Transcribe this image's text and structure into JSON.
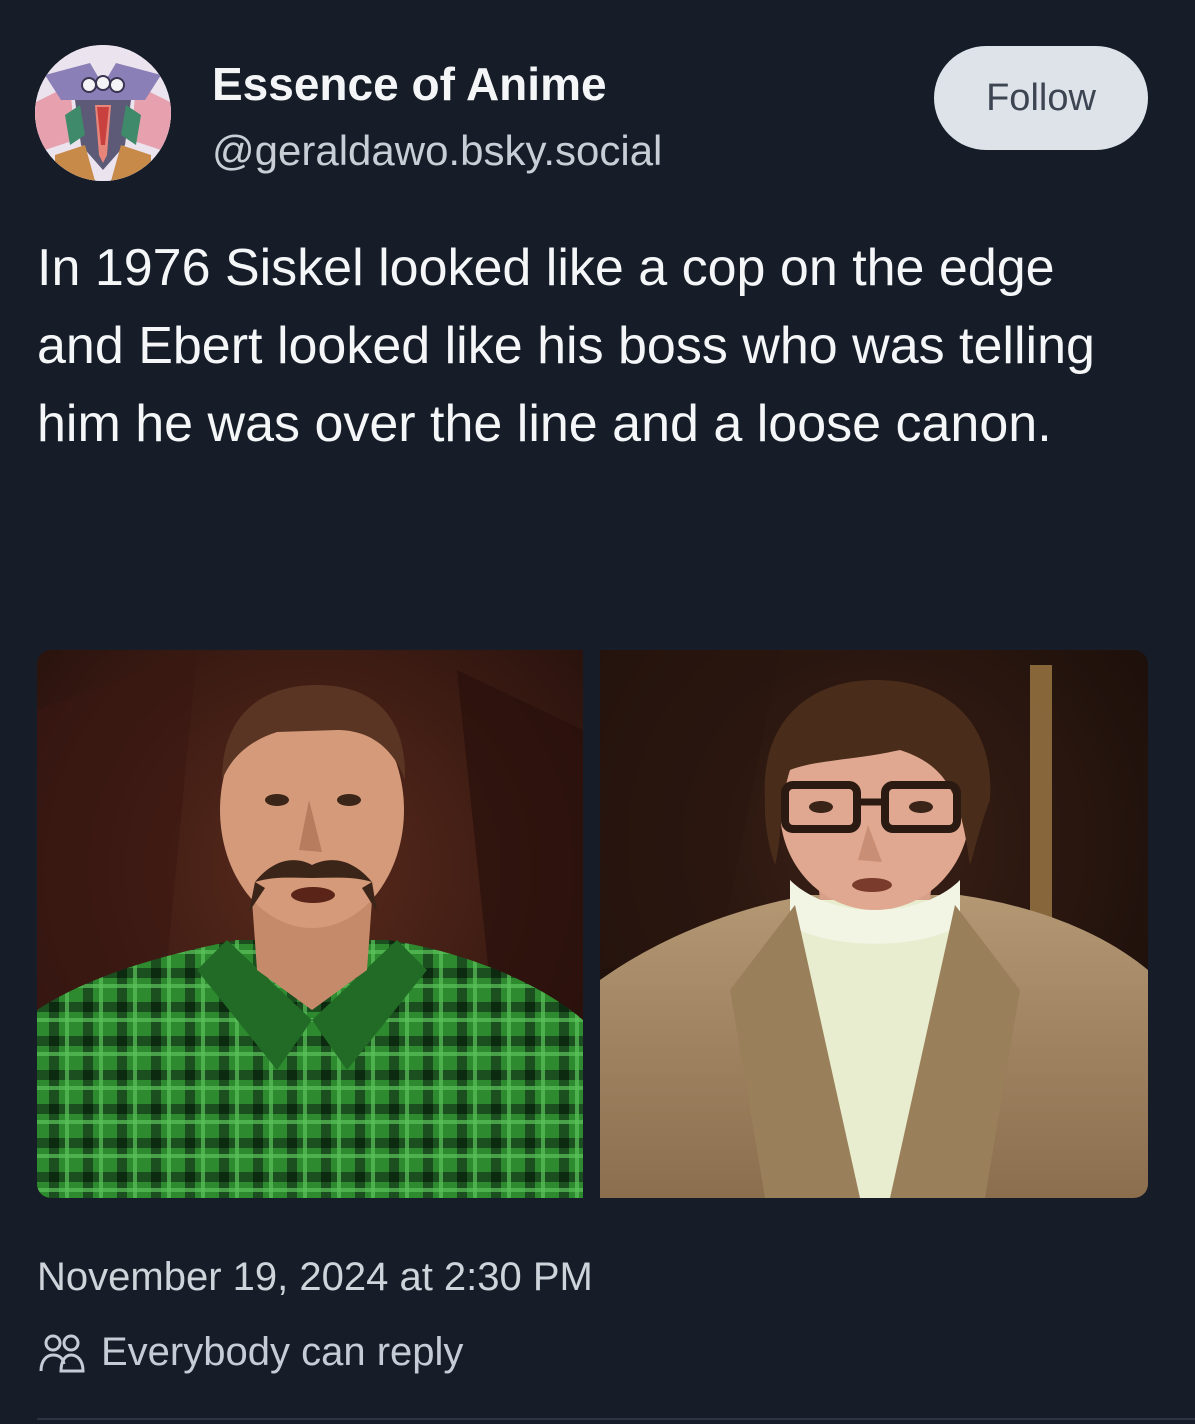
{
  "author": {
    "display_name": "Essence of Anime",
    "handle": "@geraldawo.bsky.social",
    "avatar_icon": "anime-mecha-avatar"
  },
  "follow_button": {
    "label": "Follow"
  },
  "post": {
    "text": "In 1976 Siskel looked like a cop on the edge and Ebert looked like his boss who was telling him he was over the line and a loose canon.",
    "images": [
      {
        "icon": "photo-man-plaid-shirt-mustache"
      },
      {
        "icon": "photo-man-glasses-tweed-jacket"
      }
    ],
    "timestamp": "November 19, 2024 at 2:30 PM",
    "reply_setting": {
      "icon": "people-icon",
      "label": "Everybody can reply"
    }
  },
  "colors": {
    "background": "#161d28",
    "text_primary": "#f3f5f7",
    "text_secondary": "#c9ced6",
    "follow_bg": "#dee3ea",
    "follow_text": "#3d4553"
  }
}
